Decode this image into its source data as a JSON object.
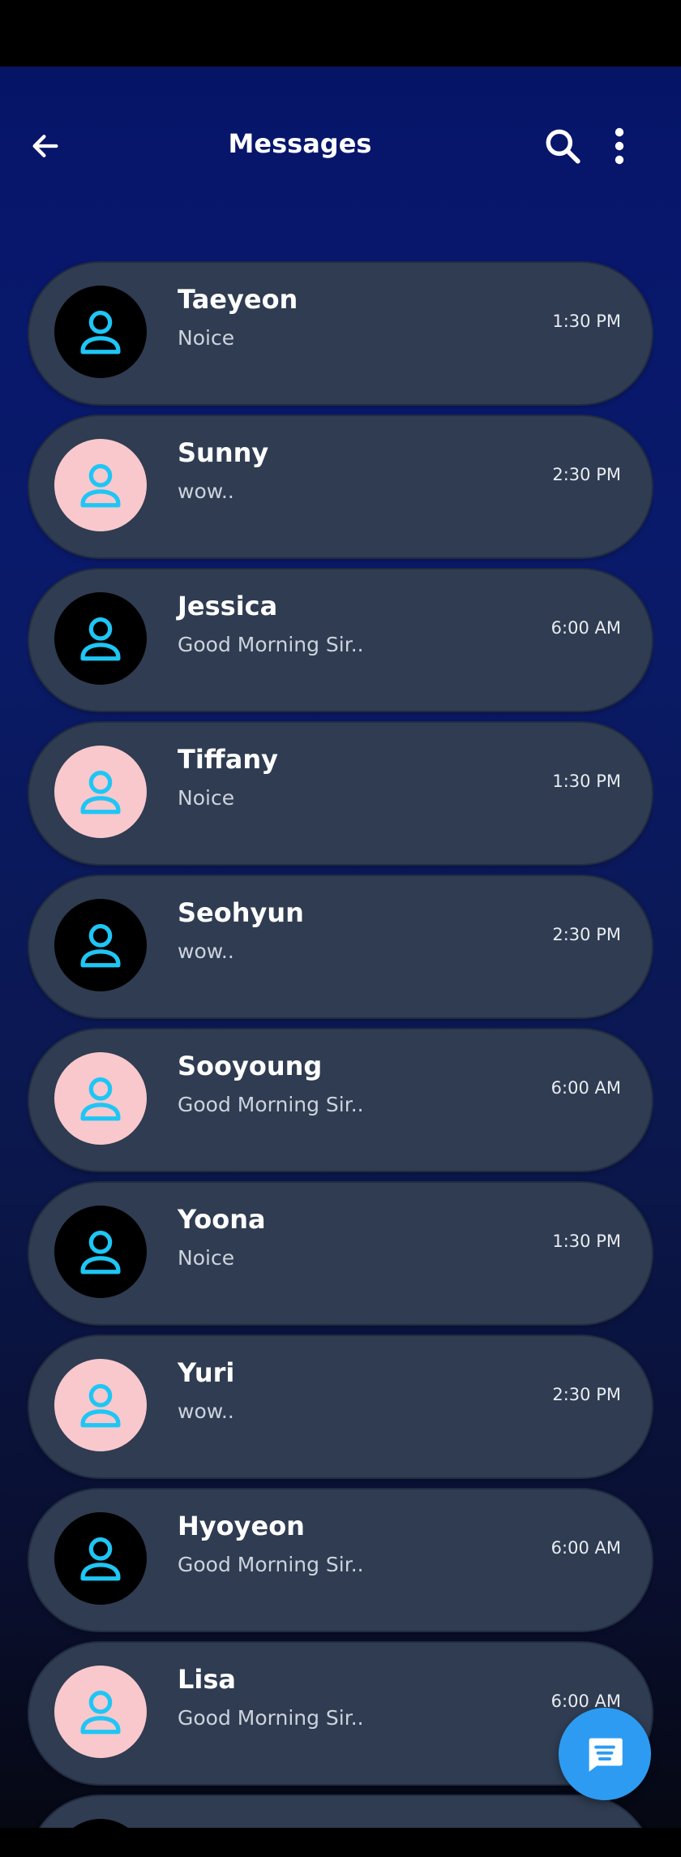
{
  "toolbar": {
    "title": "Messages"
  },
  "icons": {
    "back": "arrow-left-icon",
    "search": "search-icon",
    "more": "more-vertical-icon",
    "avatar": "person-icon",
    "fab": "chat-icon"
  },
  "colors": {
    "avatar_dark": "#000000",
    "avatar_pink": "#f8c8cc",
    "avatar_icon": "#1ec6f5",
    "card": "#2f3c51",
    "fab": "#2d9bf2"
  },
  "conversations": [
    {
      "name": "Taeyeon",
      "preview": "Noice",
      "time": "1:30 PM",
      "avatar": "dark"
    },
    {
      "name": "Sunny",
      "preview": "wow..",
      "time": "2:30 PM",
      "avatar": "pink"
    },
    {
      "name": "Jessica",
      "preview": "Good Morning Sir..",
      "time": "6:00 AM",
      "avatar": "dark"
    },
    {
      "name": "Tiffany",
      "preview": "Noice",
      "time": "1:30 PM",
      "avatar": "pink"
    },
    {
      "name": "Seohyun",
      "preview": "wow..",
      "time": "2:30 PM",
      "avatar": "dark"
    },
    {
      "name": "Sooyoung",
      "preview": "Good Morning Sir..",
      "time": "6:00 AM",
      "avatar": "pink"
    },
    {
      "name": "Yoona",
      "preview": "Noice",
      "time": "1:30 PM",
      "avatar": "dark"
    },
    {
      "name": "Yuri",
      "preview": "wow..",
      "time": "2:30 PM",
      "avatar": "pink"
    },
    {
      "name": "Hyoyeon",
      "preview": "Good Morning Sir..",
      "time": "6:00 AM",
      "avatar": "dark"
    },
    {
      "name": "Lisa",
      "preview": "Good Morning Sir..",
      "time": "6:00 AM",
      "avatar": "pink"
    },
    {
      "name": "",
      "preview": "",
      "time": "",
      "avatar": "dark"
    }
  ]
}
